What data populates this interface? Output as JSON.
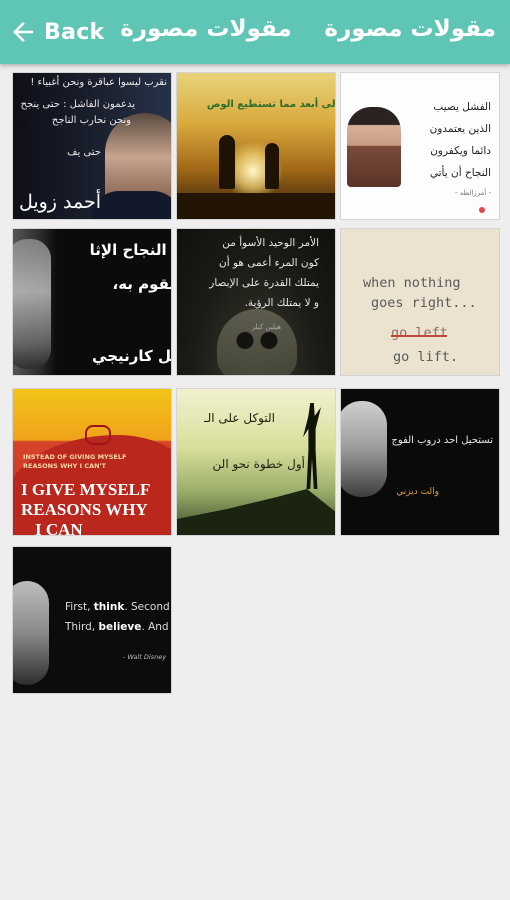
{
  "header": {
    "back_label": "Back",
    "center_title": "مقولات مصورة",
    "app_title": "مقولات مصورة",
    "background": "#5fc6b5"
  },
  "tiles": [
    {
      "lines": [
        "نقرب ليسوا عباقرة ونحن أغبياء !",
        "يدعمون الفاشل : حتى ينجح",
        "ونحن نحارب الناجح",
        "حتى يف"
      ],
      "signature": "أحمد زويل"
    },
    {
      "lines": [
        "تصل إلى أبعد مما تستطيع الوص"
      ]
    },
    {
      "lines": [
        "الفشل يصيب",
        "الذين يعتمدون",
        "دائما ويكفرون",
        "النجاح أن يأتي"
      ],
      "small": "- أمرزالطه -"
    },
    {
      "lines": [
        "يق النجاح الإثا",
        "تقوم به،",
        "يل كارنيجي"
      ]
    },
    {
      "lines": [
        "الأمر الوحيد الأسوأ من",
        "كون المرء أعمى هو أن",
        "يمتلك القدرة على الإبصار",
        "و لا يمتلك الرؤية."
      ],
      "small": "هيلين كيلر"
    },
    {
      "lines": [
        "when nothing",
        "goes right...",
        "go left",
        "go lift."
      ]
    },
    {
      "small_lines": [
        "INSTEAD OF GIVING MYSELF",
        "REASONS WHY I CAN'T"
      ],
      "big_lines": [
        "I GIVE MYSELF",
        "REASONS WHY",
        "I CAN"
      ]
    },
    {
      "lines": [
        "التوكل على الـ",
        "أول خطوة نحو الن"
      ]
    },
    {
      "lines": [
        "تستحيل احد دروب الفوج"
      ],
      "signature": "والت ديزني"
    },
    {
      "line1_a": "First, ",
      "line1_b": "think",
      "line1_c": ". Second",
      "line2_a": "Third, ",
      "line2_b": "believe",
      "line2_c": ". And fir",
      "signature": "- Walt Disney"
    }
  ]
}
